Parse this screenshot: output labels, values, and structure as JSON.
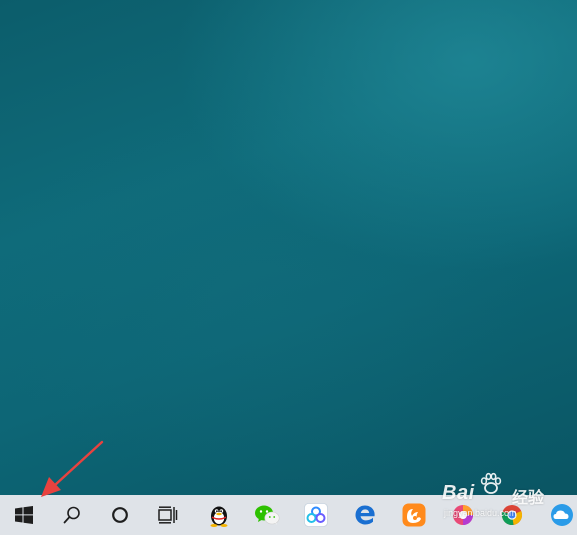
{
  "desktop": {
    "wallpaper": "teal-gradient"
  },
  "taskbar": {
    "background": "#dfe3e8",
    "buttons": [
      {
        "name": "start-button",
        "icon": "windows-logo-icon"
      },
      {
        "name": "search-button",
        "icon": "search-icon"
      },
      {
        "name": "cortana-button",
        "icon": "cortana-circle-icon"
      },
      {
        "name": "task-view-button",
        "icon": "task-view-icon"
      },
      {
        "name": "qq-app-button",
        "icon": "qq-penguin-icon"
      },
      {
        "name": "wechat-app-button",
        "icon": "wechat-icon"
      },
      {
        "name": "baidu-netdisk-app-button",
        "icon": "baidu-netdisk-icon"
      },
      {
        "name": "edge-app-button",
        "icon": "edge-icon"
      },
      {
        "name": "uc-browser-app-button",
        "icon": "uc-browser-icon"
      },
      {
        "name": "browser-app-button",
        "icon": "round-browser-icon"
      },
      {
        "name": "chrome-app-button",
        "icon": "chrome-icon"
      },
      {
        "name": "cloud-app-button",
        "icon": "cloud-icon"
      }
    ]
  },
  "annotation": {
    "arrow_color": "#e8423f"
  },
  "watermark": {
    "brand": "Bai",
    "brand_suffix": "经验",
    "url": "jingyan.baidu.com"
  }
}
